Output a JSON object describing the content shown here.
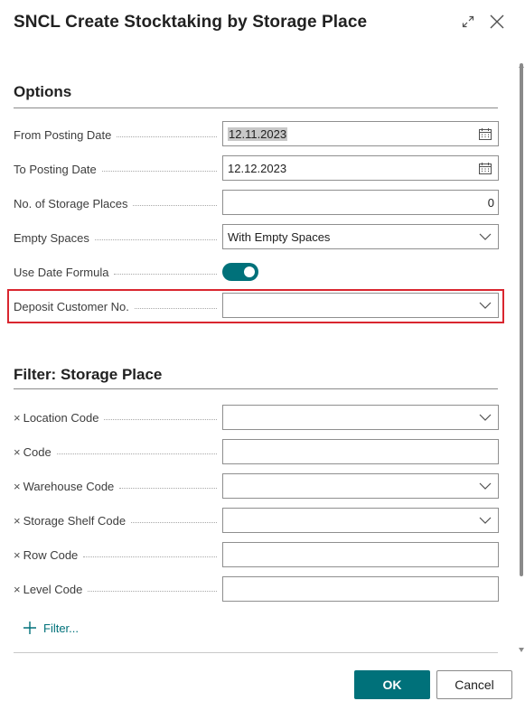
{
  "dialog": {
    "title": "SNCL Create Stocktaking by Storage Place",
    "expand_icon": "expand-icon",
    "close_icon": "close-icon"
  },
  "options": {
    "section_title": "Options",
    "fields": {
      "from_posting_date": {
        "label": "From Posting Date",
        "value": "12.11.2023",
        "icon": "calendar-icon"
      },
      "to_posting_date": {
        "label": "To Posting Date",
        "value": "12.12.2023",
        "icon": "calendar-icon"
      },
      "no_of_storage_places": {
        "label": "No. of Storage Places",
        "value": "0"
      },
      "empty_spaces": {
        "label": "Empty Spaces",
        "value": "With Empty Spaces",
        "icon": "chevron-down-icon"
      },
      "use_date_formula": {
        "label": "Use Date Formula",
        "value": true
      },
      "deposit_customer_no": {
        "label": "Deposit Customer No.",
        "value": "",
        "icon": "chevron-down-icon"
      }
    }
  },
  "filter": {
    "section_title": "Filter: Storage Place",
    "fields": {
      "location_code": {
        "label": "Location Code",
        "value": ""
      },
      "code": {
        "label": "Code",
        "value": ""
      },
      "warehouse_code": {
        "label": "Warehouse Code",
        "value": ""
      },
      "storage_shelf_code": {
        "label": "Storage Shelf Code",
        "value": ""
      },
      "row_code": {
        "label": "Row Code",
        "value": ""
      },
      "level_code": {
        "label": "Level Code",
        "value": ""
      }
    },
    "remove_glyph": "×",
    "add_filter_label": "Filter..."
  },
  "footer": {
    "ok_label": "OK",
    "cancel_label": "Cancel"
  },
  "colors": {
    "accent": "#00717a",
    "highlight": "#d9262f"
  }
}
